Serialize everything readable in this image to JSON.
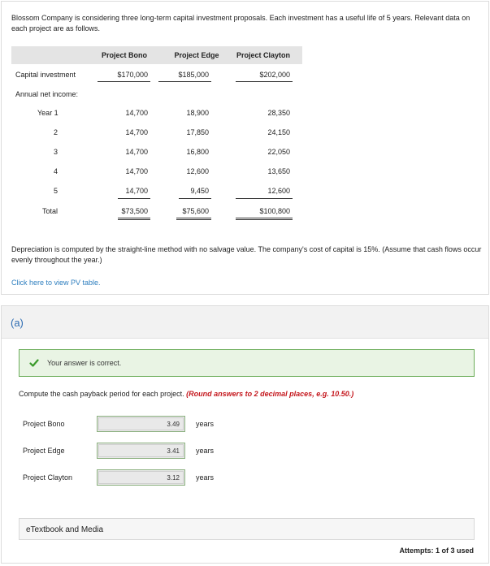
{
  "intro": "Blossom Company is considering three long-term capital investment proposals. Each investment has a useful life of 5 years. Relevant data on each project are as follows.",
  "table": {
    "headers": [
      "Project Bono",
      "Project Edge",
      "Project Clayton"
    ],
    "capital_label": "Capital investment",
    "capital": [
      "$170,000",
      "$185,000",
      "$202,000"
    ],
    "annual_label": "Annual net income:",
    "years": [
      {
        "label": "Year  1",
        "values": [
          "14,700",
          "18,900",
          "28,350"
        ]
      },
      {
        "label": "2",
        "values": [
          "14,700",
          "17,850",
          "24,150"
        ]
      },
      {
        "label": "3",
        "values": [
          "14,700",
          "16,800",
          "22,050"
        ]
      },
      {
        "label": "4",
        "values": [
          "14,700",
          "12,600",
          "13,650"
        ]
      },
      {
        "label": "5",
        "values": [
          "14,700",
          "9,450",
          "12,600"
        ]
      }
    ],
    "total_label": "Total",
    "totals": [
      "$73,500",
      "$75,600",
      "$100,800"
    ]
  },
  "depreciation": "Depreciation is computed by the straight-line method with no salvage value. The company's cost of capital is 15%. (Assume that cash flows occur evenly throughout the year.)",
  "pv_link": "Click here to view PV table.",
  "part": {
    "label": "(a)",
    "status": "Your answer is correct.",
    "question": "Compute the cash payback period for each project.",
    "hint": "(Round answers to 2 decimal places, e.g. 10.50.)",
    "answers": [
      {
        "label": "Project Bono",
        "value": "3.49",
        "unit": "years"
      },
      {
        "label": "Project Edge",
        "value": "3.41",
        "unit": "years"
      },
      {
        "label": "Project Clayton",
        "value": "3.12",
        "unit": "years"
      }
    ],
    "etext": "eTextbook and Media",
    "attempts": "Attempts: 1 of 3 used"
  }
}
